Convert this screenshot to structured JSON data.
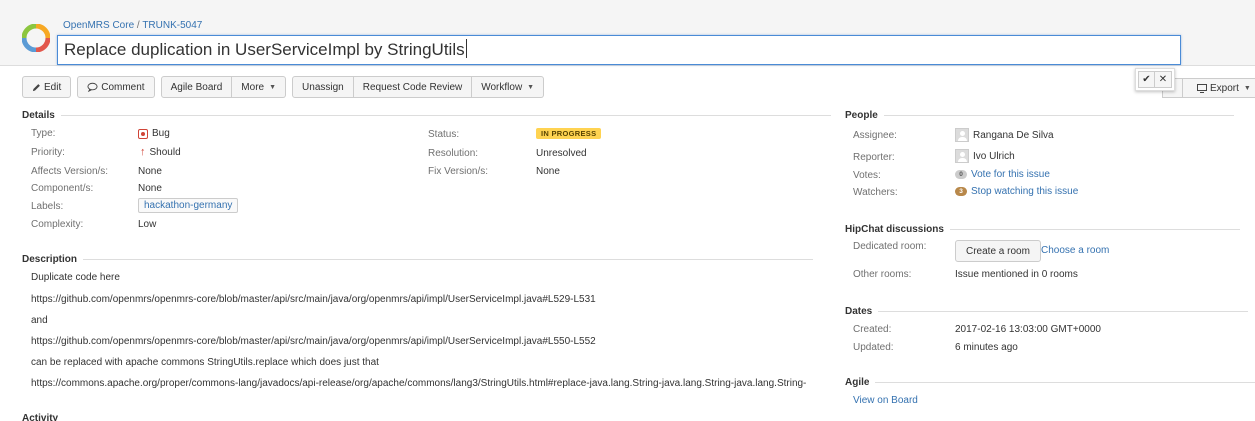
{
  "header": {
    "breadcrumb": {
      "project": "OpenMRS Core",
      "separator": "/",
      "issue_key": "TRUNK-5047"
    },
    "title_value": "Replace duplication in UserServiceImpl by StringUtils",
    "logo_colors": [
      "#f7a823",
      "#e2574c",
      "#5b9bd5",
      "#8cc63f"
    ]
  },
  "toolbar": {
    "edit": "Edit",
    "comment": "Comment",
    "agile_board": "Agile Board",
    "more": "More",
    "unassign": "Unassign",
    "request_code_review": "Request Code Review",
    "workflow": "Workflow",
    "export": "Export",
    "confirm_icon": "check-icon",
    "cancel_icon": "close-icon"
  },
  "details": {
    "heading": "Details",
    "type_label": "Type:",
    "type_value": "Bug",
    "priority_label": "Priority:",
    "priority_value": "Should",
    "affects_label": "Affects Version/s:",
    "affects_value": "None",
    "component_label": "Component/s:",
    "component_value": "None",
    "labels_label": "Labels:",
    "labels_value": "hackathon-germany",
    "complexity_label": "Complexity:",
    "complexity_value": "Low",
    "status_label": "Status:",
    "status_value": "IN PROGRESS",
    "resolution_label": "Resolution:",
    "resolution_value": "Unresolved",
    "fix_label": "Fix Version/s:",
    "fix_value": "None"
  },
  "description": {
    "heading": "Description",
    "line1": "Duplicate code here",
    "link1": "https://github.com/openmrs/openmrs-core/blob/master/api/src/main/java/org/openmrs/api/impl/UserServiceImpl.java#L529-L531",
    "line2": "and",
    "link2": "https://github.com/openmrs/openmrs-core/blob/master/api/src/main/java/org/openmrs/api/impl/UserServiceImpl.java#L550-L552",
    "line3": "can be replaced with apache commons StringUtils.replace which does just that",
    "link3": "https://commons.apache.org/proper/commons-lang/javadocs/api-release/org/apache/commons/lang3/StringUtils.html#replace-java.lang.String-java.lang.String-java.lang.String-"
  },
  "activity": {
    "heading": "Activity"
  },
  "people": {
    "heading": "People",
    "assignee_label": "Assignee:",
    "assignee_value": "Rangana De Silva",
    "reporter_label": "Reporter:",
    "reporter_value": "Ivo Ulrich",
    "votes_label": "Votes:",
    "votes_count": "0",
    "votes_link": "Vote for this issue",
    "watchers_label": "Watchers:",
    "watchers_count": "3",
    "watchers_link": "Stop watching this issue"
  },
  "hipchat": {
    "heading": "HipChat discussions",
    "dedicated_label": "Dedicated room:",
    "create_room": "Create a room",
    "choose_room": "Choose a room",
    "other_label": "Other rooms:",
    "other_value": "Issue mentioned in 0 rooms"
  },
  "dates": {
    "heading": "Dates",
    "created_label": "Created:",
    "created_value": "2017-02-16 13:03:00 GMT+0000",
    "updated_label": "Updated:",
    "updated_value": "6 minutes ago"
  },
  "agile": {
    "heading": "Agile",
    "view_on_board": "View on Board"
  }
}
